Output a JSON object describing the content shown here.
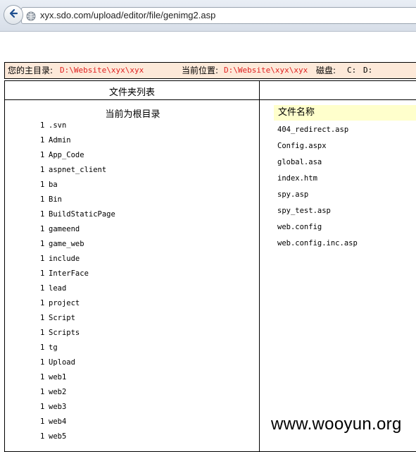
{
  "browser": {
    "url": "xyx.sdo.com/upload/editor/file/genimg2.asp"
  },
  "info_bar": {
    "home_label": "您的主目录:",
    "home_value": "D:\\Website\\xyx\\xyx",
    "current_label": "当前位置:",
    "current_value": "D:\\Website\\xyx\\xyx",
    "disk_label": "磁盘:",
    "drives": [
      "C:",
      "D:"
    ]
  },
  "folders_panel": {
    "title": "文件夹列表",
    "root_label": "当前为根目录",
    "items": [
      {
        "num": "1",
        "name": ".svn"
      },
      {
        "num": "1",
        "name": "Admin"
      },
      {
        "num": "1",
        "name": "App_Code"
      },
      {
        "num": "1",
        "name": "aspnet_client"
      },
      {
        "num": "1",
        "name": "ba"
      },
      {
        "num": "1",
        "name": "Bin"
      },
      {
        "num": "1",
        "name": "BuildStaticPage"
      },
      {
        "num": "1",
        "name": "gameend"
      },
      {
        "num": "1",
        "name": "game_web"
      },
      {
        "num": "1",
        "name": "include"
      },
      {
        "num": "1",
        "name": "InterFace"
      },
      {
        "num": "1",
        "name": "lead"
      },
      {
        "num": "1",
        "name": "project"
      },
      {
        "num": "1",
        "name": "Script"
      },
      {
        "num": "1",
        "name": "Scripts"
      },
      {
        "num": "1",
        "name": "tg"
      },
      {
        "num": "1",
        "name": "Upload"
      },
      {
        "num": "1",
        "name": "web1"
      },
      {
        "num": "1",
        "name": "web2"
      },
      {
        "num": "1",
        "name": "web3"
      },
      {
        "num": "1",
        "name": "web4"
      },
      {
        "num": "1",
        "name": "web5"
      }
    ]
  },
  "files_panel": {
    "header": "文件名称",
    "files": [
      "404_redirect.asp",
      "Config.aspx",
      "global.asa",
      "index.htm",
      "spy.asp",
      "spy_test.asp",
      "web.config",
      "web.config.inc.asp"
    ]
  },
  "watermark": "www.wooyun.org",
  "colors": {
    "info_bar_bg": "#fde9d9",
    "path_text": "#e02020",
    "file_header_bg": "#ffffcc"
  }
}
